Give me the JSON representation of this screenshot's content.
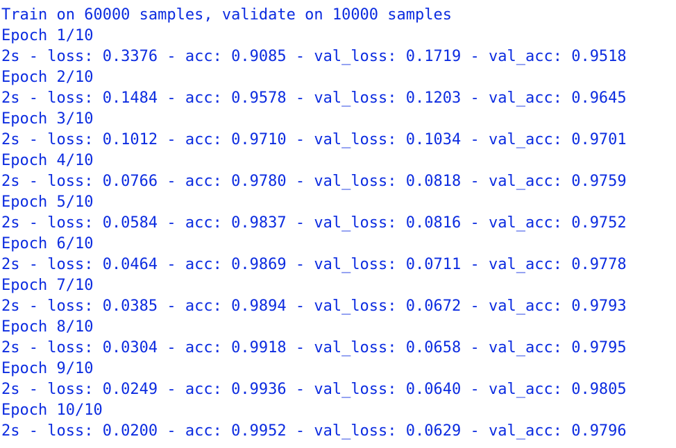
{
  "terminal": {
    "header_line": "Train on 60000 samples, validate on 10000 samples",
    "epochs": [
      {
        "epoch_label": "Epoch 1/10",
        "metrics": "2s - loss: 0.3376 - acc: 0.9085 - val_loss: 0.1719 - val_acc: 0.9518"
      },
      {
        "epoch_label": "Epoch 2/10",
        "metrics": "2s - loss: 0.1484 - acc: 0.9578 - val_loss: 0.1203 - val_acc: 0.9645"
      },
      {
        "epoch_label": "Epoch 3/10",
        "metrics": "2s - loss: 0.1012 - acc: 0.9710 - val_loss: 0.1034 - val_acc: 0.9701"
      },
      {
        "epoch_label": "Epoch 4/10",
        "metrics": "2s - loss: 0.0766 - acc: 0.9780 - val_loss: 0.0818 - val_acc: 0.9759"
      },
      {
        "epoch_label": "Epoch 5/10",
        "metrics": "2s - loss: 0.0584 - acc: 0.9837 - val_loss: 0.0816 - val_acc: 0.9752"
      },
      {
        "epoch_label": "Epoch 6/10",
        "metrics": "2s - loss: 0.0464 - acc: 0.9869 - val_loss: 0.0711 - val_acc: 0.9778"
      },
      {
        "epoch_label": "Epoch 7/10",
        "metrics": "2s - loss: 0.0385 - acc: 0.9894 - val_loss: 0.0672 - val_acc: 0.9793"
      },
      {
        "epoch_label": "Epoch 8/10",
        "metrics": "2s - loss: 0.0304 - acc: 0.9918 - val_loss: 0.0658 - val_acc: 0.9795"
      },
      {
        "epoch_label": "Epoch 9/10",
        "metrics": "2s - loss: 0.0249 - acc: 0.9936 - val_loss: 0.0640 - val_acc: 0.9805"
      },
      {
        "epoch_label": "Epoch 10/10",
        "metrics": "2s - loss: 0.0200 - acc: 0.9952 - val_loss: 0.0629 - val_acc: 0.9796"
      }
    ],
    "colors": {
      "text": "#0c2ce0",
      "warning": "#e11414",
      "background": "#ffffff"
    }
  }
}
